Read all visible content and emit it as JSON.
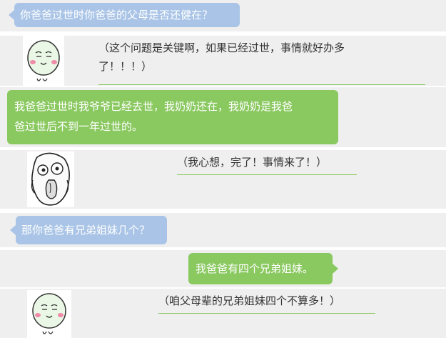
{
  "messages": [
    {
      "speaker": "other",
      "text": "你爸爸过世时你爸爸的父母是否还健在？"
    },
    {
      "speaker": "self_thought",
      "text": "（这个问题是关键啊，如果已经过世，事情就好办多了！！！）",
      "line1": "（这个问题是关键啊，如果已经过世，事情就好办多",
      "line2": "了！！！）",
      "avatar": "smile-face-icon"
    },
    {
      "speaker": "self",
      "text": "我爸爸过世时我爷爷已经去世，我奶奶还在，我奶奶是我爸爸过世后不到一年过世的。",
      "line1": "我爸爸过世时我爷爷已经去世，我奶奶还在，我奶奶是我爸",
      "line2": "爸过世后不到一年过世的。"
    },
    {
      "speaker": "self_thought",
      "text": "（我心想，完了！事情来了！）",
      "avatar": "shocked-meme-face-icon"
    },
    {
      "speaker": "other",
      "text": "那你爸爸有兄弟姐妹几个？"
    },
    {
      "speaker": "self",
      "text": "我爸爸有四个兄弟姐妹。"
    },
    {
      "speaker": "self_thought",
      "text": "（咱父母辈的兄弟姐妹四个不算多！）",
      "avatar": "smile-face-icon"
    }
  ],
  "colors": {
    "row_background": "#efefef",
    "blue_bubble": "#a9c4e6",
    "green_bubble": "#8ac860",
    "underline": "#8ac860"
  }
}
